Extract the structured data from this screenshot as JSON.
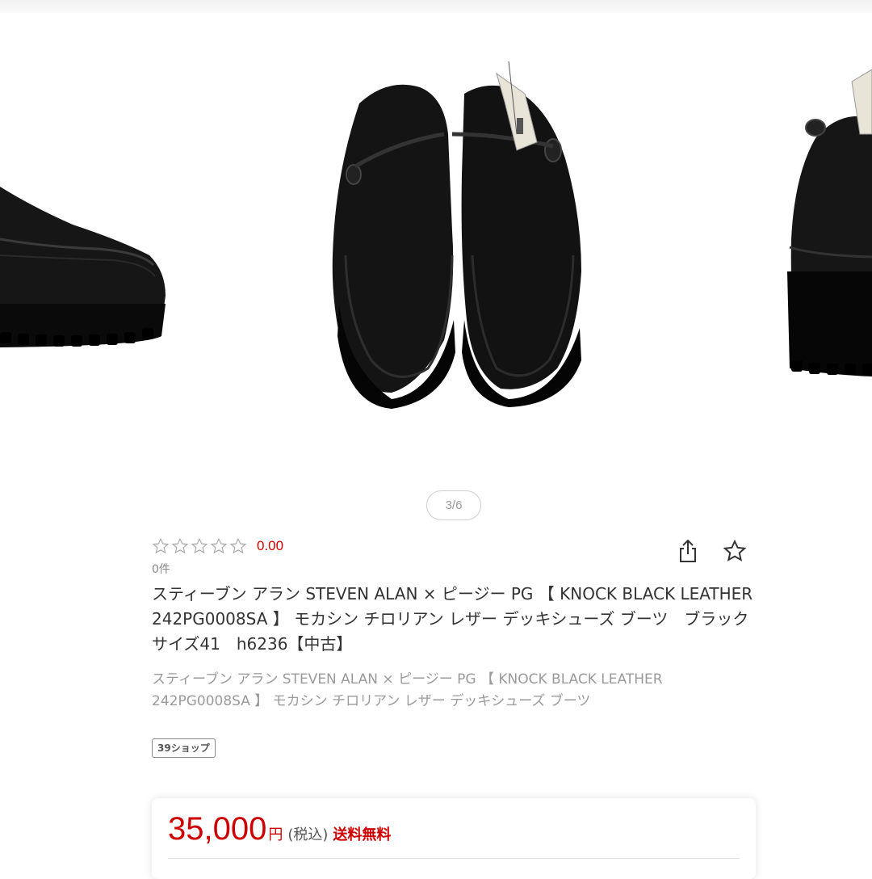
{
  "gallery": {
    "pager": "3/6",
    "current_index": 3,
    "total": 6
  },
  "product": {
    "rating": {
      "stars_filled": 0,
      "stars_total": 5,
      "value": "0.00",
      "review_count": "0件"
    },
    "title": "スティーブン アラン STEVEN ALAN × ピージー PG 【 KNOCK BLACK LEATHER 242PG0008SA 】 モカシン チロリアン レザー デッキシューズ ブーツ　ブラック　サイズ41　h6236【中古】",
    "subtitle": "スティーブン アラン STEVEN ALAN × ピージー PG 【 KNOCK BLACK LEATHER 242PG0008SA 】 モカシン チロリアン レザー デッキシューズ ブーツ",
    "shop_badge": "39ショップ",
    "icons": {
      "share": "share-icon",
      "favorite": "star-outline-icon"
    }
  },
  "price": {
    "amount": "35,000",
    "currency": "円",
    "tax": "(税込)",
    "shipping": "送料無料"
  },
  "colors": {
    "accent": "#cc0000",
    "muted": "#9a9a9a"
  }
}
